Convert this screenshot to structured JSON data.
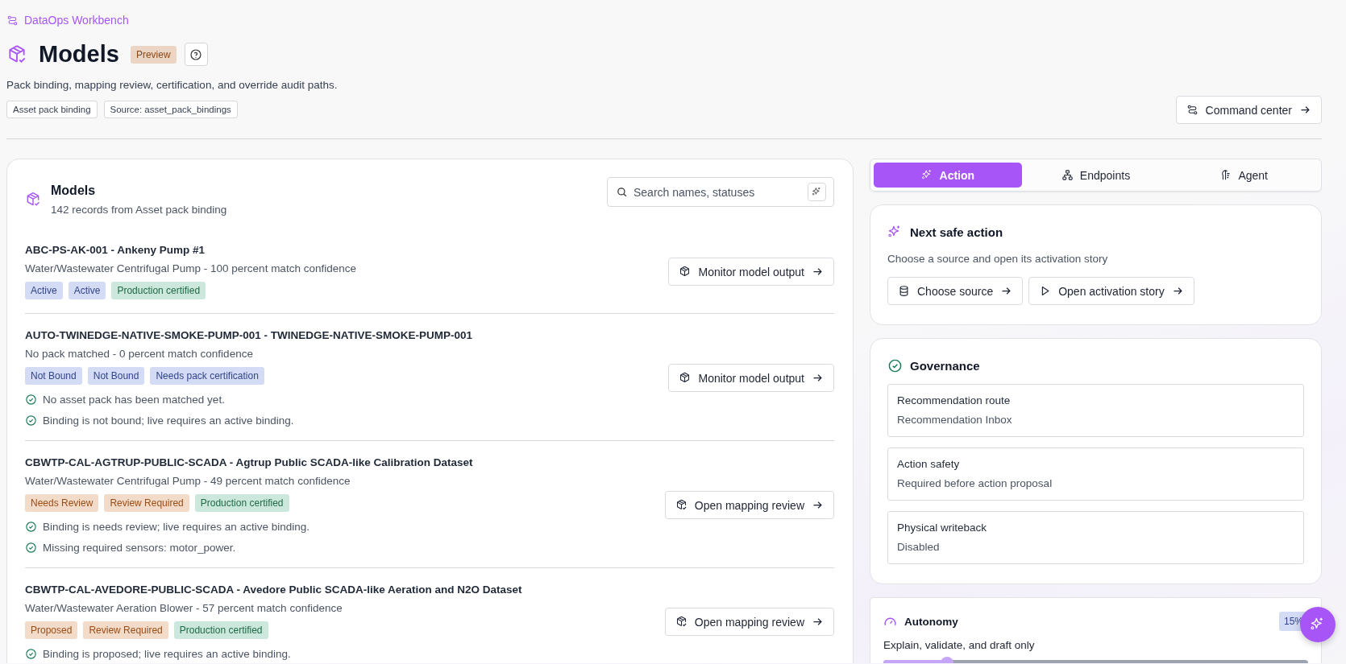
{
  "breadcrumb": "DataOps Workbench",
  "page": {
    "title": "Models",
    "badge": "Preview",
    "description": "Pack binding, mapping review, certification, and override audit paths.",
    "tags": [
      "Asset pack binding",
      "Source: asset_pack_bindings"
    ],
    "command_button": "Command center"
  },
  "list": {
    "title": "Models",
    "subtitle": "142 records from Asset pack binding",
    "search": {
      "placeholder": "Search names, statuses"
    },
    "rows": [
      {
        "title": "ABC-PS-AK-001 - Ankeny Pump #1",
        "subtitle": "Water/Wastewater Centrifugal Pump - 100 percent match confidence",
        "tags": [
          {
            "label": "Active",
            "color": "#d3dbf5"
          },
          {
            "label": "Active",
            "color": "#d3dbf5"
          },
          {
            "label": "Production certified",
            "color": "#cce7db"
          }
        ],
        "notes": [],
        "action": {
          "kind": "monitor",
          "label": "Monitor model output"
        }
      },
      {
        "title": "AUTO-TWINEDGE-NATIVE-SMOKE-PUMP-001 - TWINEDGE-NATIVE-SMOKE-PUMP-001",
        "subtitle": "No pack matched - 0 percent match confidence",
        "tags": [
          {
            "label": "Not Bound",
            "color": "#d3dbf5"
          },
          {
            "label": "Not Bound",
            "color": "#d3dbf5"
          },
          {
            "label": "Needs pack certification",
            "color": "#d3dbf5"
          }
        ],
        "notes": [
          "No asset pack has been matched yet.",
          "Binding is not bound; live requires an active binding."
        ],
        "action": {
          "kind": "monitor",
          "label": "Monitor model output"
        }
      },
      {
        "title": "CBWTP-CAL-AGTRUP-PUBLIC-SCADA - Agtrup Public SCADA-like Calibration Dataset",
        "subtitle": "Water/Wastewater Centrifugal Pump - 49 percent match confidence",
        "tags": [
          {
            "label": "Needs Review",
            "color": "#f2dbc8"
          },
          {
            "label": "Review Required",
            "color": "#f2dbc8"
          },
          {
            "label": "Production certified",
            "color": "#cce7db"
          }
        ],
        "notes": [
          "Binding is needs review; live requires an active binding.",
          "Missing required sensors: motor_power."
        ],
        "action": {
          "kind": "review",
          "label": "Open mapping review"
        }
      },
      {
        "title": "CBWTP-CAL-AVEDORE-PUBLIC-SCADA - Avedore Public SCADA-like Aeration and N2O Dataset",
        "subtitle": "Water/Wastewater Aeration Blower - 57 percent match confidence",
        "tags": [
          {
            "label": "Proposed",
            "color": "#f2dbc8"
          },
          {
            "label": "Review Required",
            "color": "#f2dbc8"
          },
          {
            "label": "Production certified",
            "color": "#cce7db"
          }
        ],
        "notes": [
          "Binding is proposed; live requires an active binding."
        ],
        "action": {
          "kind": "review",
          "label": "Open mapping review"
        }
      }
    ]
  },
  "tabs": [
    {
      "kind": "action",
      "label": "Action",
      "selected": true
    },
    {
      "kind": "endpoints",
      "label": "Endpoints",
      "selected": false
    },
    {
      "kind": "agent",
      "label": "Agent",
      "selected": false
    }
  ],
  "next_action": {
    "title": "Next safe action",
    "text": "Choose a source and open its activation story",
    "buttons": [
      {
        "kind": "source",
        "label": "Choose source"
      },
      {
        "kind": "story",
        "label": "Open activation story"
      }
    ]
  },
  "governance": {
    "title": "Governance",
    "items": [
      {
        "label": "Recommendation route",
        "value": "Recommendation Inbox"
      },
      {
        "label": "Action safety",
        "value": "Required before action proposal"
      },
      {
        "label": "Physical writeback",
        "value": "Disabled"
      }
    ]
  },
  "autonomy": {
    "title": "Autonomy",
    "badge": "15%",
    "text": "Explain, validate, and draft only",
    "level": 0.15
  }
}
